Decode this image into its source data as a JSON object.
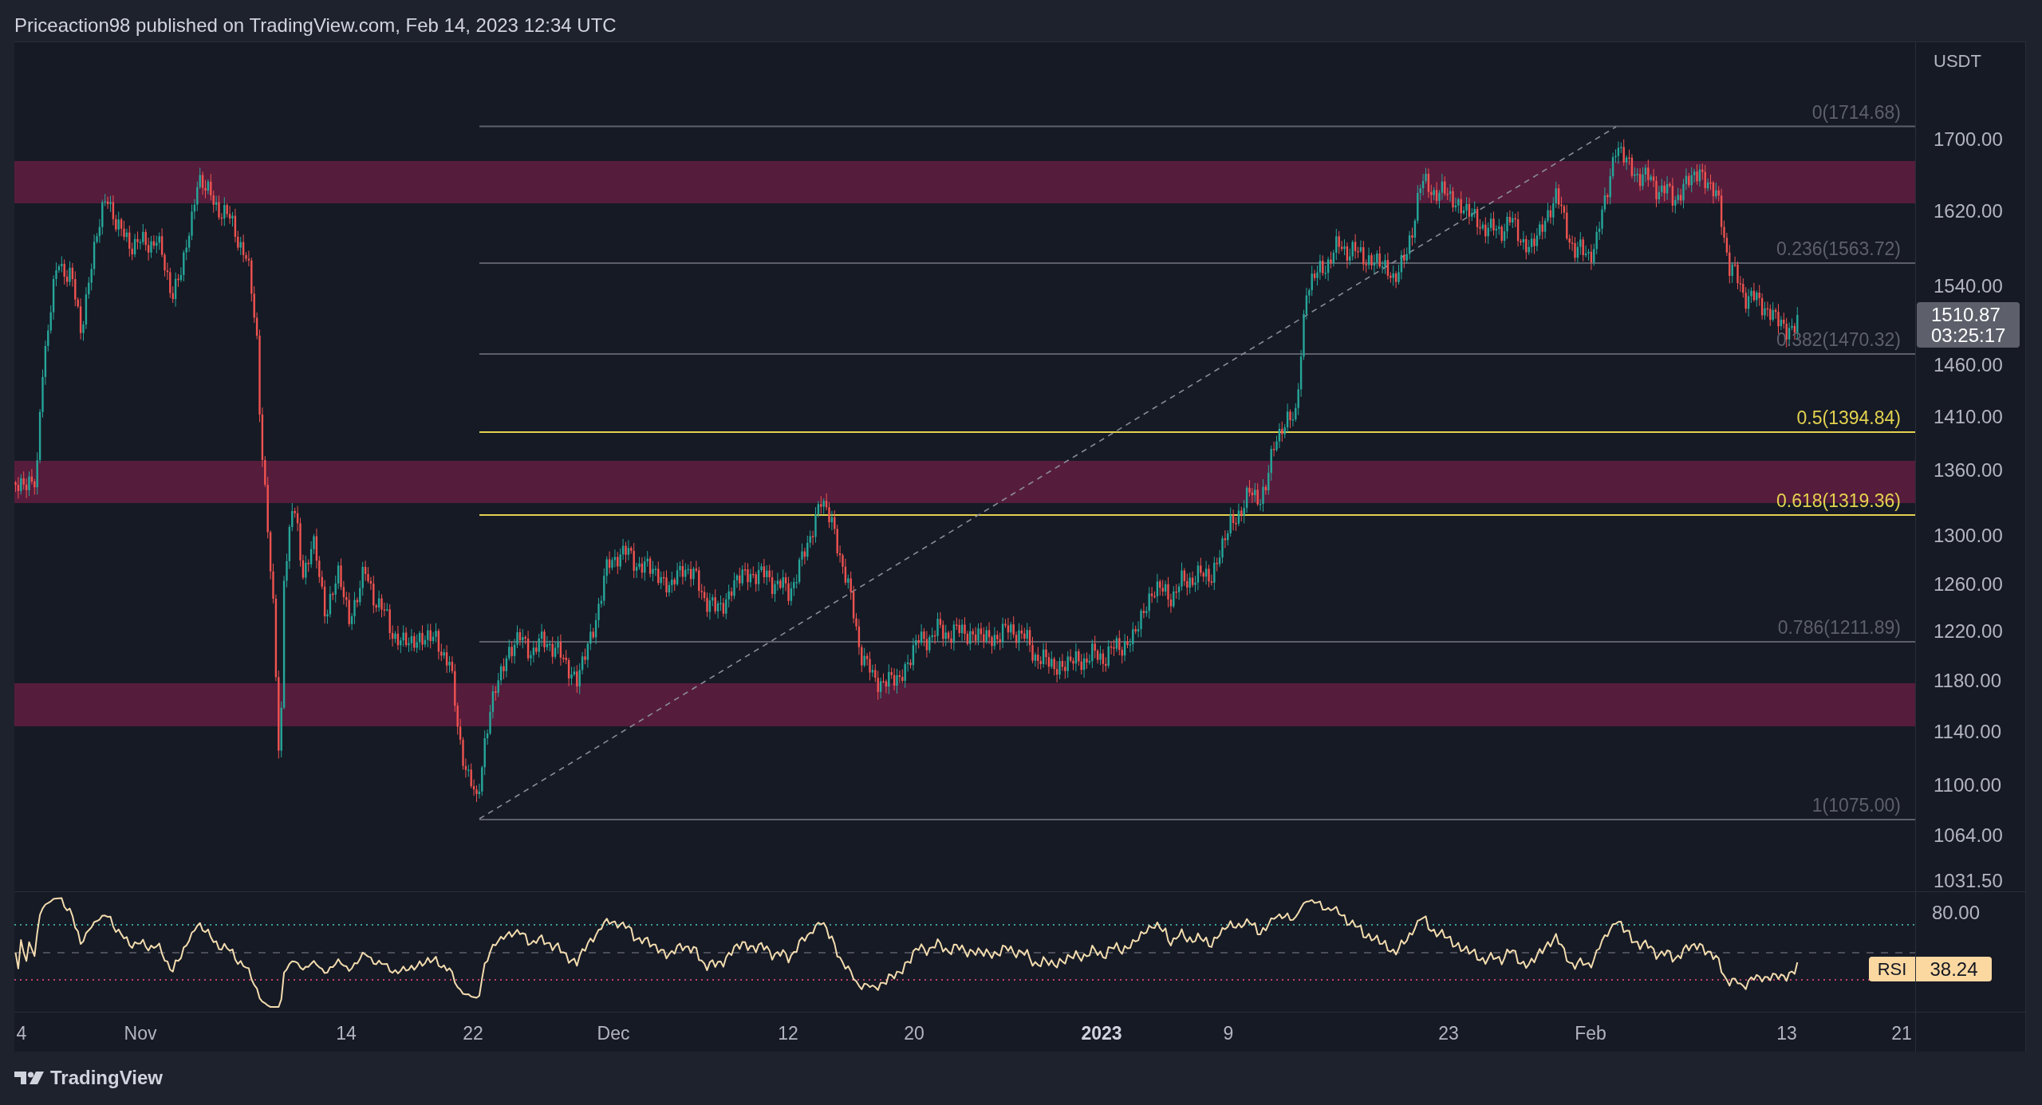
{
  "header": {
    "text": "Priceaction98 published on TradingView.com, Feb 14, 2023 12:34 UTC"
  },
  "chart": {
    "price_axis": {
      "unit": "USDT",
      "ticks": [
        "1700.00",
        "1620.00",
        "1540.00",
        "1460.00",
        "1410.00",
        "1360.00",
        "1300.00",
        "1260.00",
        "1220.00",
        "1180.00",
        "1140.00",
        "1100.00",
        "1064.00",
        "1031.50"
      ]
    },
    "last_price": {
      "value": "1510.87",
      "countdown": "03:25:17"
    },
    "fib_levels": [
      {
        "label": "0(1714.68)",
        "color": "#5d606b"
      },
      {
        "label": "0.236(1563.72)",
        "color": "#5d606b"
      },
      {
        "label": "0.382(1470.32)",
        "color": "#5d606b"
      },
      {
        "label": "0.5(1394.84)",
        "color": "#e3d24f"
      },
      {
        "label": "0.618(1319.36)",
        "color": "#e3d24f"
      },
      {
        "label": "0.786(1211.89)",
        "color": "#5d606b"
      },
      {
        "label": "1(1075.00)",
        "color": "#5d606b"
      }
    ],
    "rsi": {
      "axis_tick": "80.00",
      "name": "RSI",
      "value": "38.24"
    },
    "time_axis": [
      {
        "label": "4",
        "bold": false
      },
      {
        "label": "Nov",
        "bold": false
      },
      {
        "label": "14",
        "bold": false
      },
      {
        "label": "22",
        "bold": false
      },
      {
        "label": "Dec",
        "bold": false
      },
      {
        "label": "12",
        "bold": false
      },
      {
        "label": "20",
        "bold": false
      },
      {
        "label": "2023",
        "bold": true
      },
      {
        "label": "9",
        "bold": false
      },
      {
        "label": "23",
        "bold": false
      },
      {
        "label": "Feb",
        "bold": false
      },
      {
        "label": "13",
        "bold": false
      },
      {
        "label": "21",
        "bold": false
      }
    ]
  },
  "footer": {
    "brand": "TradingView"
  }
}
